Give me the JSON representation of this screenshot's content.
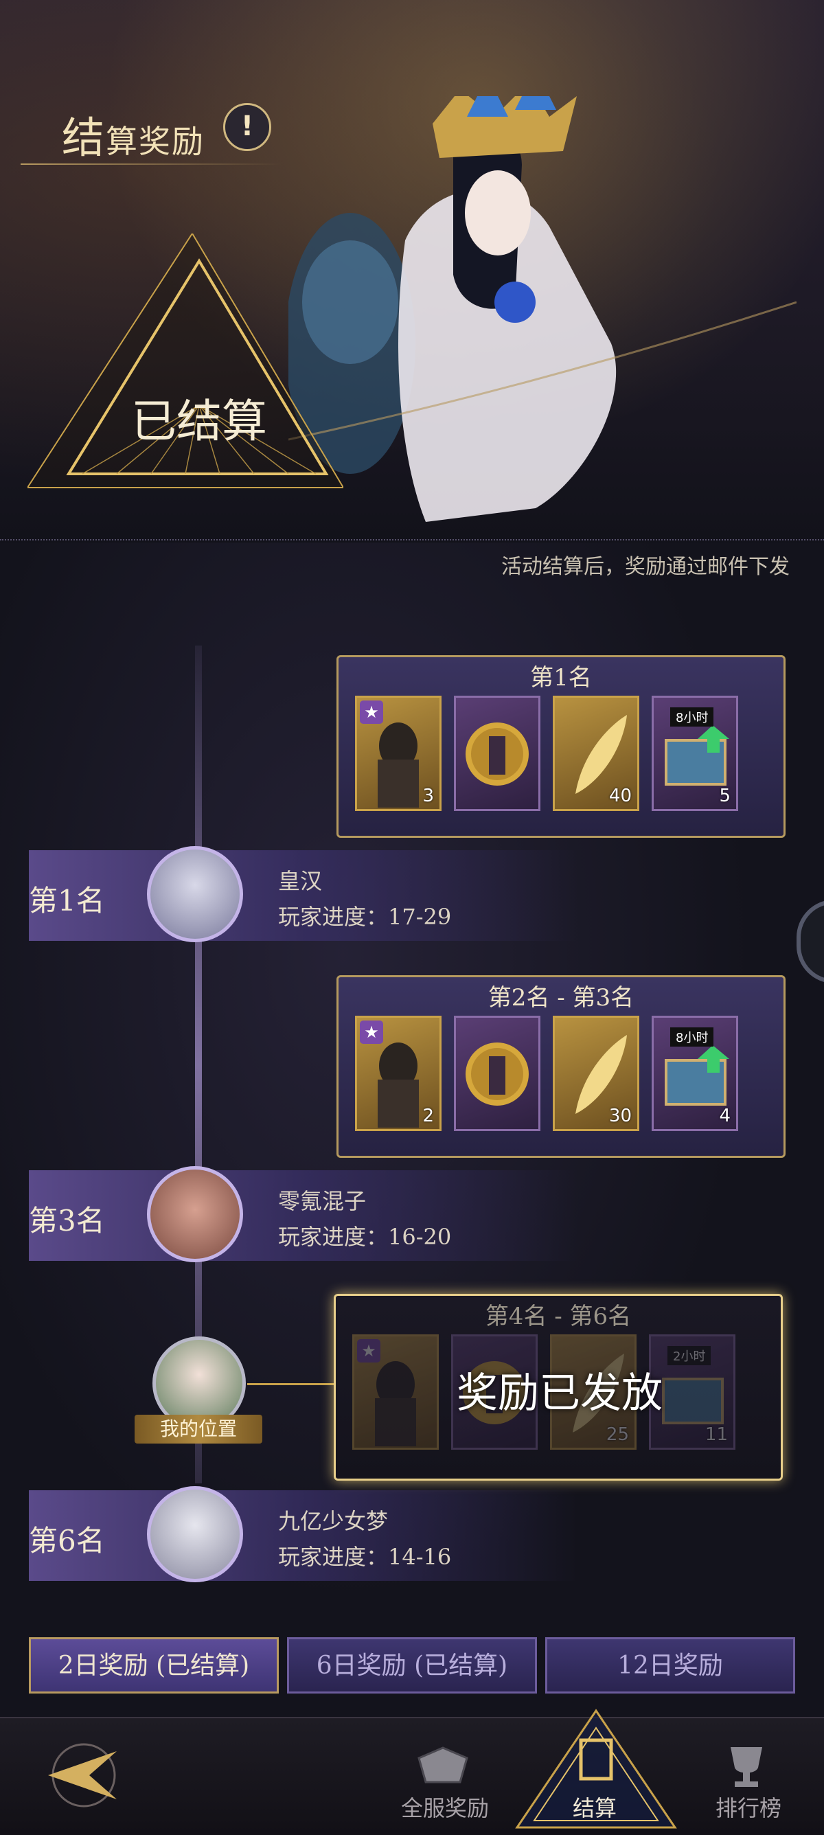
{
  "header": {
    "title_big": "结",
    "title_rest": "算奖励",
    "info_icon": "!",
    "status": "已结算",
    "notice": "活动结算后，奖励通过邮件下发"
  },
  "rewards": [
    {
      "title": "第1名",
      "items": [
        {
          "type": "character-card",
          "count": "3"
        },
        {
          "type": "token",
          "count": ""
        },
        {
          "type": "feather",
          "count": "40"
        },
        {
          "type": "chest",
          "badge": "8小时",
          "count": "5"
        }
      ]
    },
    {
      "title": "第2名 - 第3名",
      "items": [
        {
          "type": "character-card",
          "count": "2"
        },
        {
          "type": "token",
          "count": ""
        },
        {
          "type": "feather",
          "count": "30"
        },
        {
          "type": "chest",
          "badge": "8小时",
          "count": "4"
        }
      ]
    },
    {
      "title": "第4名 - 第6名",
      "issued": "奖励已发放",
      "items": [
        {
          "type": "character-card",
          "count": ""
        },
        {
          "type": "token",
          "count": ""
        },
        {
          "type": "feather",
          "count": "25"
        },
        {
          "type": "chest",
          "badge": "2小时",
          "count": "11"
        }
      ]
    }
  ],
  "ranks": [
    {
      "rank": "第1名",
      "name": "皇汉",
      "progress": "玩家进度：17-29"
    },
    {
      "rank": "第3名",
      "name": "零氪混子",
      "progress": "玩家进度：16-20"
    },
    {
      "rank": "第6名",
      "name": "九亿少女梦",
      "progress": "玩家进度：14-16"
    }
  ],
  "my_position": "我的位置",
  "day_tabs": [
    "2日奖励 (已结算)",
    "6日奖励 (已结算)",
    "12日奖励"
  ],
  "nav": {
    "all_server": "全服奖励",
    "settle": "结算",
    "ranking": "排行榜"
  },
  "colors": {
    "gold": "#b59a5e",
    "panel": "#3a3460",
    "row": "#5a4a8a"
  }
}
